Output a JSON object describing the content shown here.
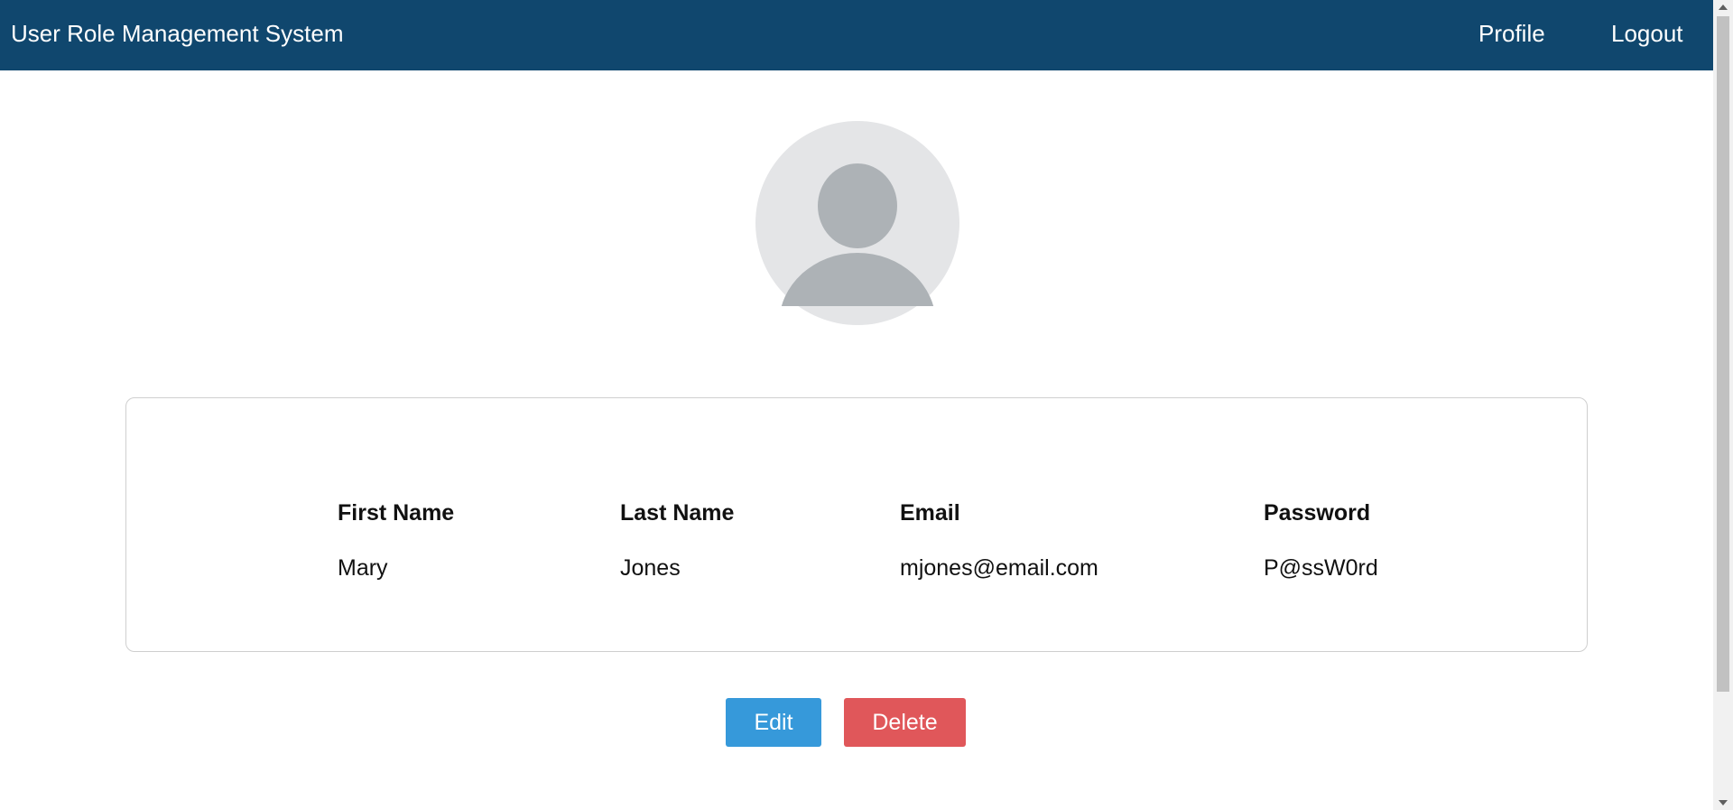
{
  "navbar": {
    "title": "User Role Management System",
    "links": {
      "profile": "Profile",
      "logout": "Logout"
    },
    "background_color": "#10476e"
  },
  "avatar": {
    "icon": "default-user-avatar"
  },
  "user_table": {
    "headers": [
      "First Name",
      "Last Name",
      "Email",
      "Password"
    ],
    "row": [
      "Mary",
      "Jones",
      "mjones@email.com",
      "P@ssW0rd"
    ]
  },
  "actions": {
    "edit_label": "Edit",
    "delete_label": "Delete",
    "edit_color": "#3699da",
    "delete_color": "#e0575a"
  }
}
